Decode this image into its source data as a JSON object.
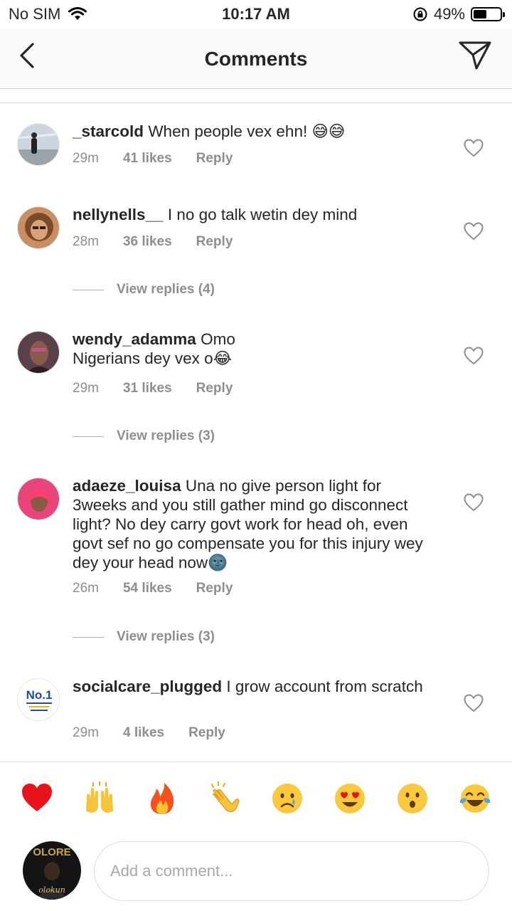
{
  "status_bar": {
    "carrier": "No SIM",
    "time": "10:17 AM",
    "battery": "49%",
    "battery_level": 0.49
  },
  "header": {
    "title": "Comments"
  },
  "comments": [
    {
      "username": "_starcold",
      "text": "When people vex ehn! 😅😅",
      "time": "29m",
      "likes": "41 likes",
      "reply": "Reply"
    },
    {
      "username": "nellynells__",
      "text": "I no go talk wetin dey mind",
      "time": "28m",
      "likes": "36 likes",
      "reply": "Reply",
      "view_replies": "View replies (4)"
    },
    {
      "username": "wendy_adamma",
      "text_line1": "Omo",
      "text_line2": "Nigerians dey vex o😂",
      "time": "29m",
      "likes": "31 likes",
      "reply": "Reply",
      "view_replies": "View replies (3)"
    },
    {
      "username": "adaeze_louisa",
      "text": "Una no give person light for 3weeks and you still gather mind go disconnect light? No dey carry govt work for head oh, even govt sef no go compensate you for this injury wey dey your head now🌚",
      "time": "26m",
      "likes": "54 likes",
      "reply": "Reply",
      "view_replies": "View replies (3)"
    },
    {
      "username": "socialcare_plugged",
      "text": "I grow account from scratch",
      "time": "29m",
      "likes": "4 likes",
      "reply": "Reply"
    }
  ],
  "avatar_texts": {
    "socialcare": "No.1",
    "composer_top": "OLORE",
    "composer_bottom": "olokun"
  },
  "reactions": [
    "❤️",
    "🙌",
    "🔥",
    "👏",
    "😢",
    "😍",
    "😮",
    "😂"
  ],
  "composer": {
    "placeholder": "Add a comment..."
  }
}
